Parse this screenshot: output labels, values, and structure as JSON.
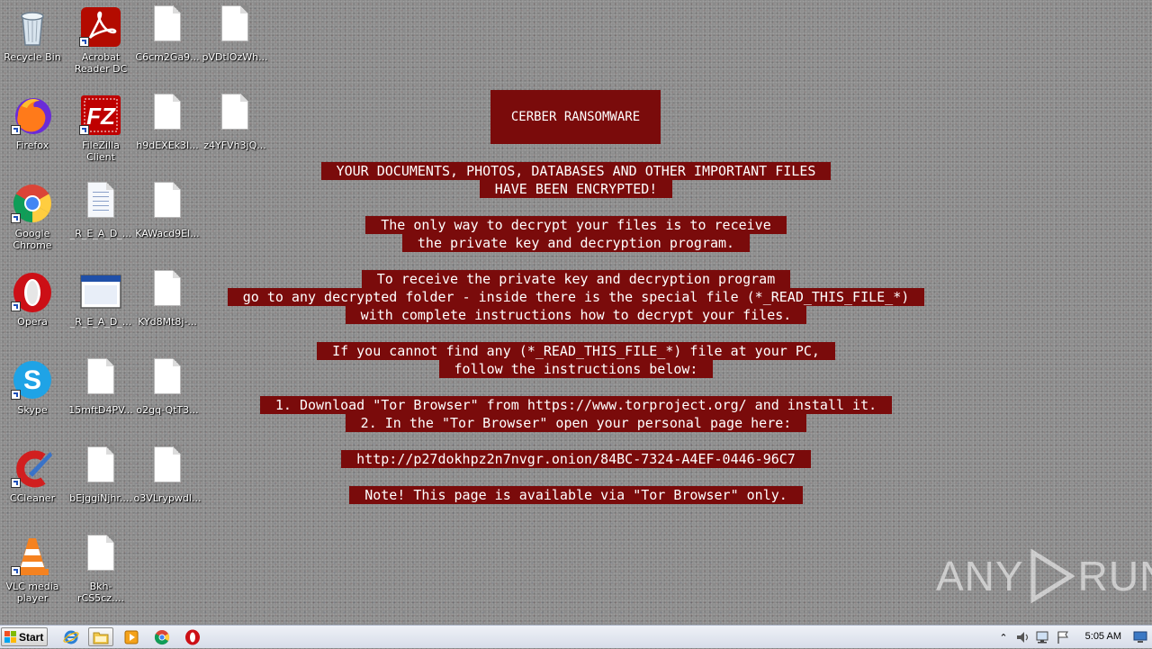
{
  "desktop": {
    "icons": [
      {
        "label": "Recycle Bin"
      },
      {
        "label": "Acrobat Reader DC"
      },
      {
        "label": "C6cm2Ga9..."
      },
      {
        "label": "pVDtlOzWh..."
      },
      {
        "label": "Firefox"
      },
      {
        "label": "FileZilla Client"
      },
      {
        "label": "h9dEXEk3I..."
      },
      {
        "label": "z4YFVh3jQ..."
      },
      {
        "label": "Google Chrome"
      },
      {
        "label": "_R_E_A_D_..."
      },
      {
        "label": "KAWacd9El..."
      },
      {
        "label": "Opera"
      },
      {
        "label": "_R_E_A_D_..."
      },
      {
        "label": "KYd8Mt8j-..."
      },
      {
        "label": "Skype"
      },
      {
        "label": "15mftD4PV..."
      },
      {
        "label": "o2gq-QtT3..."
      },
      {
        "label": "CCleaner"
      },
      {
        "label": "bEjggiNjhr...."
      },
      {
        "label": "o3VLrypwdl..."
      },
      {
        "label": "VLC media player"
      },
      {
        "label": "Bkh-rCS5cz...."
      }
    ]
  },
  "note": {
    "title": "CERBER RANSOMWARE",
    "lines": [
      "YOUR DOCUMENTS, PHOTOS, DATABASES AND OTHER IMPORTANT FILES",
      "HAVE BEEN ENCRYPTED!",
      "The only way to decrypt your files is to receive",
      "the private key and decryption program.",
      "To receive the private key and decryption program",
      "go to any decrypted folder - inside there is the special file (*_READ_THIS_FILE_*)",
      "with complete instructions how to decrypt your files.",
      "If you cannot find any (*_READ_THIS_FILE_*) file at your PC,",
      "follow the instructions below:",
      "1. Download \"Tor Browser\" from https://www.torproject.org/ and install it.",
      "2. In the \"Tor Browser\" open your personal page here:",
      "http://p27dokhpz2n7nvgr.onion/84BC-7324-A4EF-0446-96C7",
      "Note! This page is available via \"Tor Browser\" only."
    ],
    "colors": {
      "highlight": "#7a0b0b",
      "text": "#ffffff"
    }
  },
  "watermark": {
    "left": "ANY",
    "right": "RUN"
  },
  "taskbar": {
    "start_label": "Start",
    "pinned": [
      "internet-explorer-icon",
      "file-explorer-icon",
      "media-player-icon",
      "chrome-icon",
      "opera-icon"
    ],
    "clock": "5:05 AM"
  }
}
